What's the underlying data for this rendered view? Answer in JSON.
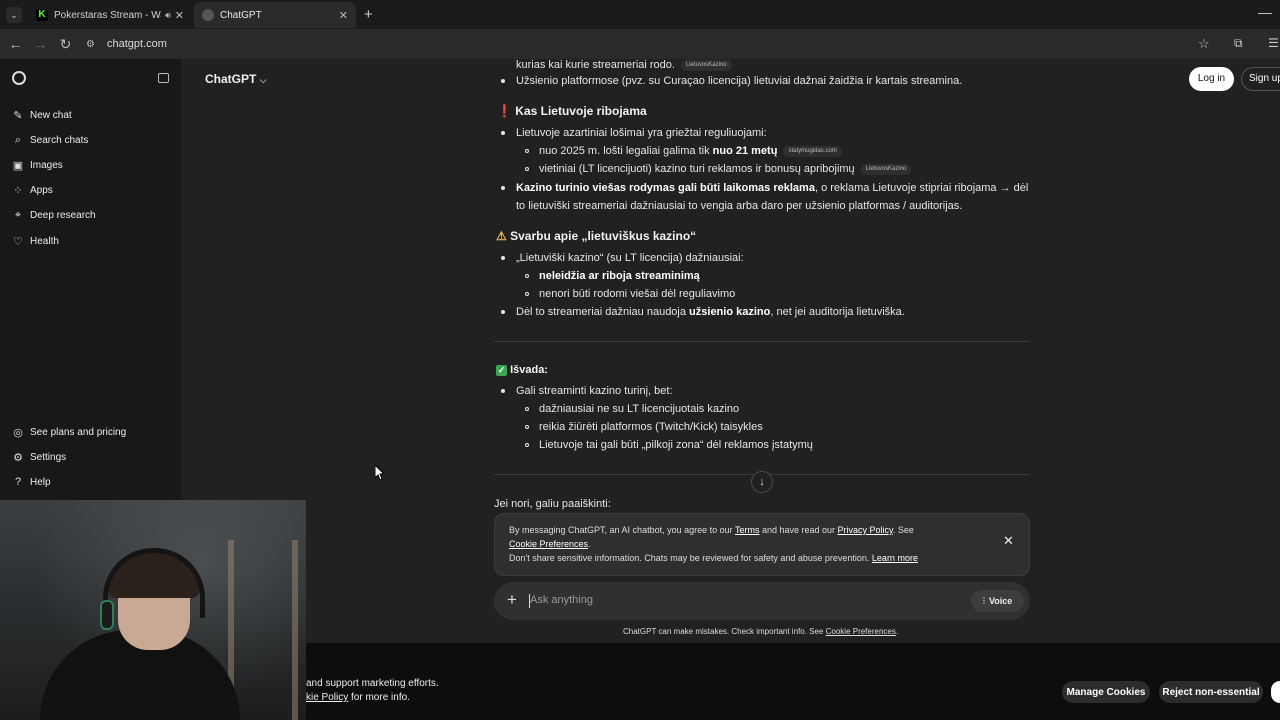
{
  "browser": {
    "tabs": [
      {
        "title": "Pokerstaras Stream - Watch",
        "favicon_color": "#53fc18"
      },
      {
        "title": "ChatGPT",
        "favicon_color": "#bbbbbb"
      }
    ],
    "url": "chatgpt.com"
  },
  "sidebar": {
    "top_items": [
      {
        "label": "New chat",
        "icon": "edit-icon"
      },
      {
        "label": "Search chats",
        "icon": "search-icon"
      },
      {
        "label": "Images",
        "icon": "image-icon"
      },
      {
        "label": "Apps",
        "icon": "apps-icon"
      },
      {
        "label": "Deep research",
        "icon": "telescope-icon"
      },
      {
        "label": "Health",
        "icon": "heart-icon"
      }
    ],
    "bottom_items": [
      {
        "label": "See plans and pricing",
        "icon": "plans-icon"
      },
      {
        "label": "Settings",
        "icon": "gear-icon"
      },
      {
        "label": "Help",
        "icon": "help-icon"
      }
    ]
  },
  "header": {
    "model": "ChatGPT",
    "login": "Log in",
    "signup": "Sign up"
  },
  "chat": {
    "line_top_partial": "kurias kai kurie streameriai rodo.",
    "line_top_partial_src": "LietuvosKazino",
    "line_top2": "Užsienio platformose (pvz. su Curaçao licencija) lietuviai dažnai žaidžia ir kartais streamina.",
    "section1_title": "Kas Lietuvoje ribojama",
    "s1_b1": "Lietuvoje azartiniai lošimai yra griežtai reguliuojami:",
    "s1_sub1_a": "nuo 2025 m. lošti legaliai galima tik ",
    "s1_sub1_b": "nuo 21 metų",
    "s1_sub1_src": "statymugidas.com",
    "s1_sub2": "vietiniai (LT licencijuoti) kazino turi reklamos ir bonusų apribojimų",
    "s1_sub2_src": "LietuvosKazino",
    "s1_b2_bold": "Kazino turinio viešas rodymas gali būti laikomas reklama",
    "s1_b2_rest": ", o reklama Lietuvoje stipriai ribojama → dėl",
    "s1_b2_line2": "to lietuviški streameriai dažniausiai to vengia arba daro per užsienio platformas / auditorijas.",
    "section2_title": "Svarbu apie „lietuviškus kazino“",
    "s2_b1": "„Lietuviški kazino“ (su LT licencija) dažniausiai:",
    "s2_sub1": "neleidžia ar riboja streaminimą",
    "s2_sub2": "nenori būti rodomi viešai dėl reguliavimo",
    "s2_b2_a": "Dėl to streameriai dažniau naudoja ",
    "s2_b2_b": "užsienio kazino",
    "s2_b2_c": ", net jei auditorija lietuviška.",
    "section3_title": "Išvada:",
    "s3_b1": "Gali streaminti kazino turinį, bet:",
    "s3_sub1": "dažniausiai ne su LT licencijuotais kazino",
    "s3_sub2": "reikia žiūrėti platformos (Twitch/Kick) taisykles",
    "s3_sub3": "Lietuvoje tai gali būti „pilkoji zona“ dėl reklamos įstatymų",
    "closing": "Jei nori, galiu paaiškinti:"
  },
  "consent": {
    "t1": "By messaging ChatGPT, an AI chatbot, you agree to our ",
    "terms": "Terms",
    "t2": " and have read our ",
    "privacy": "Privacy Policy",
    "t3": ". See",
    "cookie_pref": "Cookie Preferences",
    "t4": ".",
    "t5": "Don't share sensitive information. Chats may be reviewed for safety and abuse prevention. ",
    "learn": "Learn more"
  },
  "composer": {
    "placeholder": "Ask anything",
    "voice": "Voice"
  },
  "disclaimer": {
    "text": "ChatGPT can make mistakes. Check important info. See ",
    "link": "Cookie Preferences",
    "end": "."
  },
  "cookie_banner": {
    "line1": "and support marketing efforts.",
    "line2_link": "kie Policy",
    "line2_rest": " for more info.",
    "manage": "Manage Cookies",
    "reject": "Reject non-essential"
  }
}
